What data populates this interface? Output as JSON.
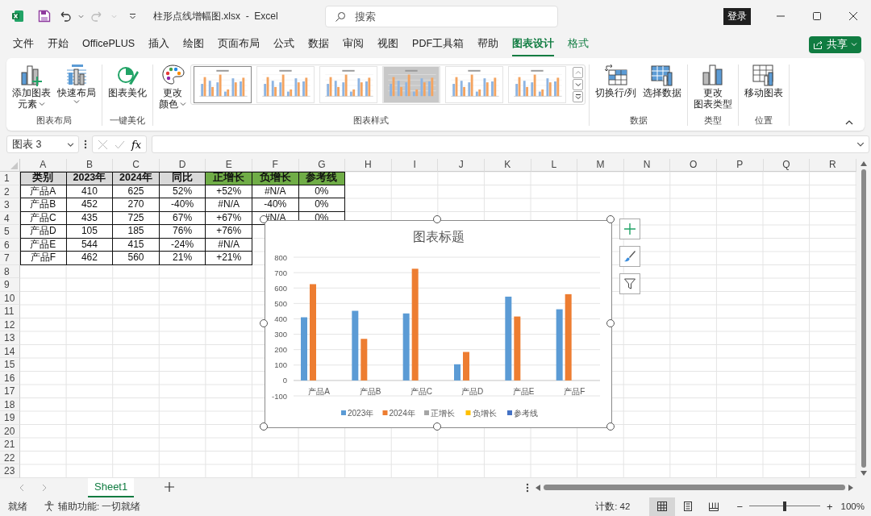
{
  "title_bar": {
    "file_title": "柱形点线增幅图.xlsx  -  Excel",
    "search": {
      "placeholder": "搜索"
    },
    "login_label": "登录",
    "redo": {
      "disabled": true
    }
  },
  "menu_tabs": [
    {
      "label": "文件",
      "selected": false,
      "contextual": false
    },
    {
      "label": "开始",
      "selected": false,
      "contextual": false
    },
    {
      "label": "OfficePLUS",
      "selected": false,
      "contextual": false
    },
    {
      "label": "插入",
      "selected": false,
      "contextual": false
    },
    {
      "label": "绘图",
      "selected": false,
      "contextual": false
    },
    {
      "label": "页面布局",
      "selected": false,
      "contextual": false
    },
    {
      "label": "公式",
      "selected": false,
      "contextual": false
    },
    {
      "label": "数据",
      "selected": false,
      "contextual": false
    },
    {
      "label": "审阅",
      "selected": false,
      "contextual": false
    },
    {
      "label": "视图",
      "selected": false,
      "contextual": false
    },
    {
      "label": "PDF工具箱",
      "selected": false,
      "contextual": false
    },
    {
      "label": "帮助",
      "selected": false,
      "contextual": false
    },
    {
      "label": "图表设计",
      "selected": true,
      "contextual": true
    },
    {
      "label": "格式",
      "selected": false,
      "contextual": true
    }
  ],
  "share_button": {
    "label": "共享"
  },
  "ribbon": {
    "groups": [
      {
        "title": "图表布局",
        "buttons": [
          {
            "kind": "add-element",
            "lines": [
              "添加图表",
              "元素"
            ],
            "dropdown": true
          },
          {
            "kind": "quick-layout",
            "lines": [
              "快速布局"
            ],
            "dropdown": true
          }
        ]
      },
      {
        "title": "一键美化",
        "buttons": [
          {
            "kind": "beautify",
            "lines": [
              "图表美化"
            ],
            "dropdown": false
          }
        ]
      },
      {
        "title": "图表样式",
        "buttons": [
          {
            "kind": "palette",
            "lines": [
              "更改",
              "颜色"
            ],
            "dropdown": true
          }
        ],
        "gallery": [
          {
            "selected": true,
            "shaded": false
          },
          {
            "selected": false,
            "shaded": false
          },
          {
            "selected": false,
            "shaded": false
          },
          {
            "selected": false,
            "shaded": true
          },
          {
            "selected": false,
            "shaded": false
          },
          {
            "selected": false,
            "shaded": false
          }
        ]
      },
      {
        "title": "数据",
        "buttons": [
          {
            "kind": "switch",
            "lines": [
              "切换行/列"
            ],
            "dropdown": false
          },
          {
            "kind": "select-data",
            "lines": [
              "选择数据"
            ],
            "dropdown": false
          }
        ]
      },
      {
        "title": "类型",
        "buttons": [
          {
            "kind": "chart-type",
            "lines": [
              "更改",
              "图表类型"
            ],
            "dropdown": false
          }
        ]
      },
      {
        "title": "位置",
        "buttons": [
          {
            "kind": "move",
            "lines": [
              "移动图表"
            ],
            "dropdown": false
          }
        ]
      }
    ]
  },
  "formula_bar": {
    "name_box": "图表 3",
    "function_label": "fx"
  },
  "sheet": {
    "columns": [
      "A",
      "B",
      "C",
      "D",
      "E",
      "F",
      "G",
      "H",
      "I",
      "J",
      "K",
      "L",
      "M",
      "N",
      "O",
      "P",
      "Q",
      "R"
    ],
    "rows": [
      {
        "number": "1",
        "cells": [
          {
            "text": "类别",
            "color": "#d9d9d9"
          },
          {
            "text": "2023年",
            "color": "#d9d9d9"
          },
          {
            "text": "2024年",
            "color": "#d9d9d9"
          },
          {
            "text": "同比",
            "color": "#d9d9d9"
          },
          {
            "text": "正增长",
            "color": "#70ad47"
          },
          {
            "text": "负增长",
            "color": "#70ad47"
          },
          {
            "text": "参考线",
            "color": "#70ad47"
          }
        ]
      },
      {
        "number": "2",
        "cells": [
          "产品A",
          "410",
          "625",
          "52%",
          "+52%",
          "#N/A",
          "0%"
        ]
      },
      {
        "number": "3",
        "cells": [
          "产品B",
          "452",
          "270",
          "-40%",
          "#N/A",
          "-40%",
          "0%"
        ]
      },
      {
        "number": "4",
        "cells": [
          "产品C",
          "435",
          "725",
          "67%",
          "+67%",
          "#N/A",
          "0%"
        ]
      },
      {
        "number": "5",
        "cells": [
          "产品D",
          "105",
          "185",
          "76%",
          "+76%"
        ]
      },
      {
        "number": "6",
        "cells": [
          "产品E",
          "544",
          "415",
          "-24%",
          "#N/A"
        ]
      },
      {
        "number": "7",
        "cells": [
          "产品F",
          "462",
          "560",
          "21%",
          "+21%"
        ]
      },
      {
        "number": "8"
      },
      {
        "number": "9"
      },
      {
        "number": "10"
      },
      {
        "number": "11"
      },
      {
        "number": "12"
      },
      {
        "number": "13"
      },
      {
        "number": "14"
      },
      {
        "number": "15"
      },
      {
        "number": "16"
      },
      {
        "number": "17"
      },
      {
        "number": "18"
      },
      {
        "number": "19"
      },
      {
        "number": "20"
      },
      {
        "number": "21"
      },
      {
        "number": "22"
      },
      {
        "number": "23"
      }
    ]
  },
  "chart": {
    "chart_data": {
      "type": "bar",
      "title": "图表标题",
      "categories": [
        "产品A",
        "产品B",
        "产品C",
        "产品D",
        "产品E",
        "产品F"
      ],
      "series": [
        {
          "name": "2023年",
          "color": "#5b9bd5",
          "values": [
            410,
            452,
            435,
            105,
            544,
            462
          ]
        },
        {
          "name": "2024年",
          "color": "#ed7d31",
          "values": [
            625,
            270,
            725,
            185,
            415,
            560
          ]
        },
        {
          "name": "正增长",
          "color": "#a5a5a5",
          "values": [
            0,
            null,
            0,
            0,
            null,
            0
          ]
        },
        {
          "name": "负增长",
          "color": "#ffc000",
          "values": [
            null,
            0,
            null,
            null,
            0,
            null
          ]
        },
        {
          "name": "参考线",
          "color": "#4472c4",
          "values": [
            0,
            0,
            0,
            0,
            0,
            0
          ]
        }
      ],
      "grid": true,
      "legend": true,
      "ylim": [
        -100,
        800
      ],
      "yticks": [
        -100,
        0,
        100,
        200,
        300,
        400,
        500,
        600,
        700,
        800
      ]
    }
  },
  "sheet_tabs": [
    {
      "label": "Sheet1",
      "selected": true
    }
  ],
  "status_bar": {
    "ready": "就绪",
    "accessibility": "辅助功能: 一切就绪",
    "count": "计数: 42",
    "views": [
      {
        "kind": "normal",
        "selected": true
      },
      {
        "kind": "page-layout",
        "selected": false
      },
      {
        "kind": "page-break",
        "selected": false
      }
    ],
    "zoom_out": "−",
    "zoom_in": "+",
    "zoom": {
      "level": 0.5
    },
    "zoom_label": "100%"
  }
}
